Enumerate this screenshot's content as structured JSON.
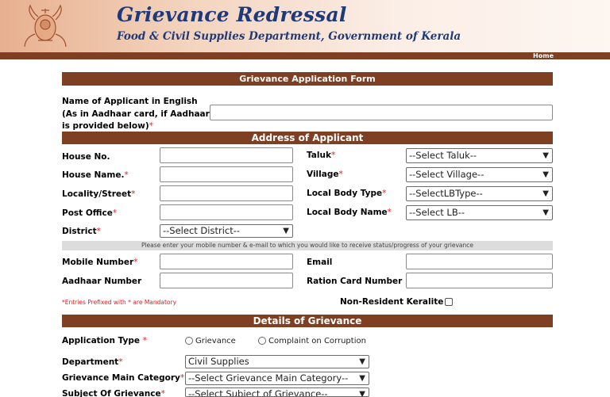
{
  "header": {
    "title": "Grievance Redressal",
    "subtitle": "Food & Civil Supplies Department, Government of Kerala",
    "emblem_icon": "kerala-emblem-icon"
  },
  "nav": {
    "home": "Home"
  },
  "form": {
    "title": "Grievance Application Form",
    "applicant_name_label_1": "Name of Applicant in English",
    "applicant_name_label_2": "(As in Aadhaar card, if Aadhaar",
    "applicant_name_label_3": "is provided below)",
    "address_section": "Address of Applicant",
    "house_no": "House No.",
    "house_name": "House Name.",
    "locality": "Locality/Street",
    "post_office": "Post Office",
    "district": "District",
    "district_select": "--Select District--",
    "taluk": "Taluk",
    "taluk_select": "--Select Taluk--",
    "village": "Village",
    "village_select": "--Select Village--",
    "local_body_type": "Local Body Type",
    "lb_type_select": "--SelectLBType--",
    "local_body_name": "Local Body Name",
    "lb_select": "--Select LB--",
    "notice": "Please enter your mobile number & e-mail to which you would like to receive status/progress of your grievance",
    "mobile": "Mobile Number",
    "email": "Email",
    "aadhaar": "Aadhaar Number",
    "ration_card": "Ration Card Number",
    "mandatory_note": "*Entries Prefixed with * are Mandatory",
    "non_resident": "Non-Resident Keralite",
    "details_section": "Details of Grievance",
    "application_type": "Application Type",
    "radio_grievance": "Grievance",
    "radio_complaint": "Complaint on Corruption",
    "department": "Department",
    "department_select": "Civil Supplies",
    "main_category": "Grievance Main Category",
    "main_category_select": "--Select Grievance Main Category--",
    "subject": "Subject Of Grievance",
    "subject_select": "--Select Subject of Grievance--",
    "required_mark": "*"
  }
}
